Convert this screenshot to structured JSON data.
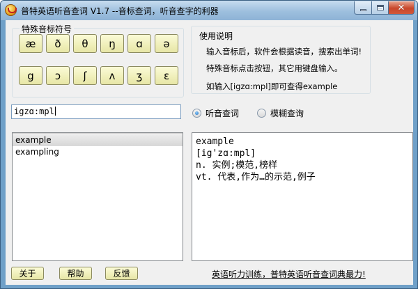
{
  "window": {
    "title": "普特英语听音查词 V1.7 --音标查词，听音查字的利器"
  },
  "symbols": {
    "group_label": "特殊音标符号",
    "row1": [
      "æ",
      "ð",
      "θ",
      "ŋ",
      "ɑ",
      "ə"
    ],
    "row2": [
      "g",
      "ɔ",
      "ʃ",
      "ʌ",
      "ʒ",
      "ɛ"
    ]
  },
  "help": {
    "title": "使用说明",
    "line1": "输入音标后，软件会根据读音，搜索出单词!",
    "line2": "特殊音标点击按钮，其它用键盘输入。",
    "line3": "如输入[igzɑ:mpl]即可查得example"
  },
  "search": {
    "value": "igzɑ:mpl"
  },
  "modes": {
    "listen_label": "听音查词",
    "fuzzy_label": "模糊查询",
    "selected": "listen"
  },
  "results": [
    "example",
    "exampling"
  ],
  "detail": {
    "word": "example",
    "phonetic": "[ig'zɑ:mpl]",
    "def1": "n. 实例;模范,榜样",
    "def2": "vt. 代表,作为…的示范,例子"
  },
  "buttons": {
    "about": "关于",
    "help": "帮助",
    "feedback": "反馈"
  },
  "promo_link": "英语听力训练，普特英语听音查词典最力!"
}
